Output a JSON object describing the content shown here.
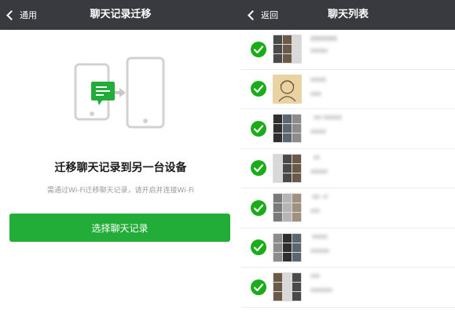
{
  "left": {
    "back_label": "通用",
    "title": "聊天记录迁移",
    "heading": "迁移聊天记录到另一台设备",
    "hint": "需通过Wi-Fi迁移聊天记录，请开启并连接Wi-Fi",
    "button_label": "选择聊天记录",
    "accent_color": "#22ac38"
  },
  "right": {
    "back_label": "返回",
    "title": "聊天列表",
    "rows": [
      {
        "checked": true,
        "avatar": "group-grid"
      },
      {
        "checked": true,
        "avatar": "single-portrait"
      },
      {
        "checked": true,
        "avatar": "group-grid"
      },
      {
        "checked": true,
        "avatar": "group-grid"
      },
      {
        "checked": true,
        "avatar": "group-grid"
      },
      {
        "checked": true,
        "avatar": "group-grid"
      },
      {
        "checked": true,
        "avatar": "group-grid"
      }
    ],
    "check_color": "#1aad19"
  },
  "topbar_color": "#393a3f",
  "icons": [
    "chevron-left-icon",
    "phone-transfer-icon",
    "checkmark-icon"
  ]
}
